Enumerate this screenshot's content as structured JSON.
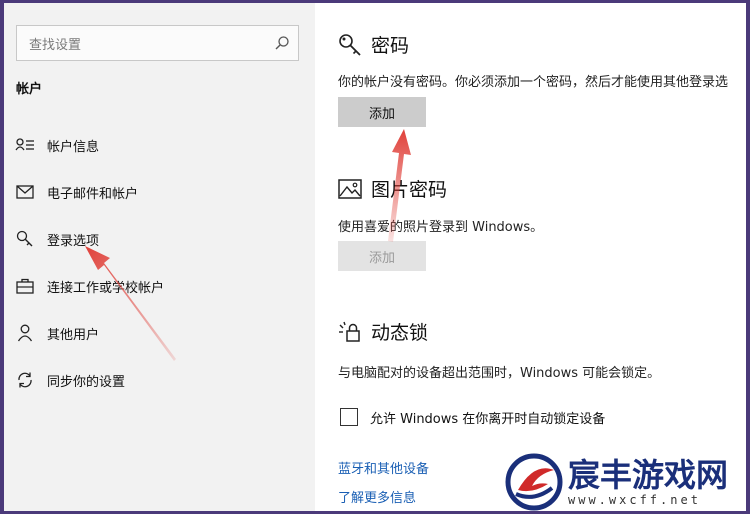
{
  "sidebar": {
    "search_placeholder": "查找设置",
    "section_title": "帐户",
    "items": [
      {
        "label": "帐户信息",
        "icon": "account-info-icon"
      },
      {
        "label": "电子邮件和帐户",
        "icon": "mail-icon"
      },
      {
        "label": "登录选项",
        "icon": "key-icon"
      },
      {
        "label": "连接工作或学校帐户",
        "icon": "briefcase-icon"
      },
      {
        "label": "其他用户",
        "icon": "person-icon"
      },
      {
        "label": "同步你的设置",
        "icon": "sync-icon"
      }
    ]
  },
  "main": {
    "password": {
      "title": "密码",
      "desc": "你的帐户没有密码。你必须添加一个密码，然后才能使用其他登录选",
      "button": "添加"
    },
    "picture_password": {
      "title": "图片密码",
      "desc": "使用喜爱的照片登录到 Windows。",
      "button": "添加"
    },
    "dynamic_lock": {
      "title": "动态锁",
      "desc": "与电脑配对的设备超出范围时，Windows 可能会锁定。",
      "checkbox_label": "允许 Windows 在你离开时自动锁定设备",
      "checked": false
    },
    "links": {
      "bluetooth": "蓝牙和其他设备",
      "learn_more": "了解更多信息"
    }
  },
  "watermark": {
    "title": "宸丰游戏网",
    "url": "www.wxcff.net"
  },
  "colors": {
    "arrow": "#e0413a",
    "link": "#1a5fb4",
    "button": "#cccccc",
    "sidebar_bg": "#f2f2f2",
    "border_bg": "#4b3a7a"
  }
}
